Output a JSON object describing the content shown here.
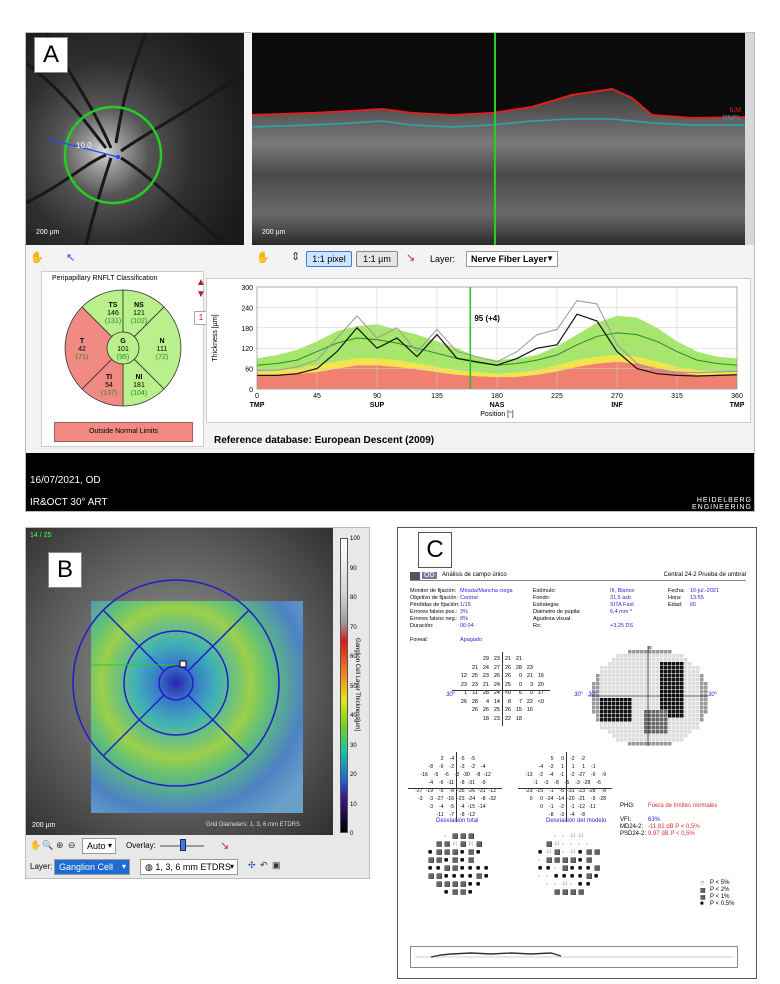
{
  "panelA": {
    "letter": "A",
    "scale_fundus": "200 µm",
    "scale_oct": "200 µm",
    "fundus_measure": "10.0",
    "layer_labels": {
      "ilm": "ILM",
      "rnfl": "RNFL"
    },
    "toolbar": {
      "pixel_btn": "1:1 pixel",
      "um_btn": "1:1 µm",
      "layer_label": "Layer:",
      "layer_value": "Nerve Fiber Layer"
    },
    "classification": {
      "title": "Peripapillary RNFLT Classification",
      "sectors": [
        {
          "id": "TS",
          "value": "146",
          "normal": "(131)",
          "status": "normal"
        },
        {
          "id": "NS",
          "value": "121",
          "normal": "(102)",
          "status": "normal"
        },
        {
          "id": "T",
          "value": "42",
          "normal": "(71)",
          "status": "outside"
        },
        {
          "id": "G",
          "value": "101",
          "normal": "(95)",
          "status": "normal"
        },
        {
          "id": "N",
          "value": "111",
          "normal": "(72)",
          "status": "normal"
        },
        {
          "id": "TI",
          "value": "54",
          "normal": "(137)",
          "status": "outside"
        },
        {
          "id": "NI",
          "value": "181",
          "normal": "(104)",
          "status": "normal"
        }
      ],
      "result": "Outside Normal Limits"
    },
    "page_indicator": "1",
    "chart_data": {
      "type": "line",
      "ylabel": "Thickness [µm]",
      "xlabel": "Position [°]",
      "xlim": [
        0,
        360
      ],
      "ylim": [
        0,
        300
      ],
      "x_ticks": [
        "0",
        "45",
        "90",
        "135",
        "180",
        "225",
        "270",
        "315",
        "360"
      ],
      "y_ticks": [
        "0",
        "60",
        "120",
        "180",
        "240",
        "300"
      ],
      "x_region_labels": [
        {
          "x": 0,
          "label": "TMP"
        },
        {
          "x": 90,
          "label": "SUP"
        },
        {
          "x": 180,
          "label": "NAS"
        },
        {
          "x": 270,
          "label": "INF"
        },
        {
          "x": 360,
          "label": "TMP"
        }
      ],
      "cursor": {
        "x": 160,
        "label": "95 (+4)"
      },
      "x": [
        0,
        15,
        30,
        45,
        60,
        75,
        90,
        105,
        120,
        135,
        150,
        165,
        180,
        195,
        210,
        225,
        240,
        255,
        270,
        285,
        300,
        315,
        330,
        345,
        360
      ],
      "series": [
        {
          "values": [
            40,
            40,
            45,
            60,
            110,
            180,
            120,
            150,
            95,
            160,
            90,
            80,
            70,
            90,
            120,
            130,
            220,
            200,
            110,
            60,
            45,
            40,
            38,
            40,
            42
          ]
        },
        {
          "values": [
            55,
            55,
            65,
            85,
            150,
            215,
            150,
            180,
            110,
            175,
            110,
            95,
            80,
            110,
            160,
            175,
            260,
            250,
            130,
            75,
            55,
            50,
            48,
            50,
            52
          ]
        }
      ],
      "normal_band": {
        "upper": [
          90,
          100,
          115,
          140,
          170,
          185,
          190,
          175,
          160,
          140,
          120,
          95,
          85,
          90,
          100,
          125,
          160,
          195,
          215,
          210,
          180,
          140,
          110,
          95,
          90
        ],
        "mean": [
          70,
          75,
          85,
          110,
          135,
          150,
          145,
          135,
          120,
          105,
          90,
          78,
          70,
          75,
          85,
          100,
          130,
          155,
          165,
          160,
          140,
          110,
          85,
          75,
          70
        ],
        "borderline": [
          50,
          55,
          60,
          70,
          80,
          90,
          90,
          85,
          75,
          65,
          55,
          50,
          45,
          48,
          55,
          70,
          85,
          95,
          100,
          95,
          80,
          65,
          55,
          50,
          50
        ],
        "lower": [
          40,
          42,
          45,
          50,
          60,
          70,
          70,
          65,
          58,
          50,
          42,
          38,
          35,
          36,
          42,
          52,
          65,
          75,
          80,
          75,
          62,
          50,
          42,
          40,
          40
        ]
      }
    },
    "reference_db": "Reference database: European Descent (2009)",
    "exam_date": "16/07/2021, OD",
    "exam_mode": "IR&OCT 30° ART",
    "brand_line1": "HEIDELBERG",
    "brand_line2": "ENGINEERING"
  },
  "panelB": {
    "letter": "B",
    "counter": "14 / 25",
    "scale": "200 µm",
    "colorbar_title": "Ganglion Cell Layer Thickness[µm]",
    "colorbar_ticks": [
      "100",
      "90",
      "80",
      "70",
      "60",
      "50",
      "40",
      "30",
      "20",
      "10",
      "0"
    ],
    "footer_text": "Grid Diameters: 1, 3, 6 mm ETDRS",
    "toolbar": {
      "auto": "Auto",
      "overlay": "Overlay:",
      "layer_label": "Layer:",
      "layer_value": "Ganglion Cell Layer",
      "grid_value": "1, 3, 6 mm ETDRS"
    }
  },
  "panelC": {
    "letter": "C",
    "header": {
      "eye": "OD",
      "title": "Análisis de campo único",
      "program": "Central 24-2 Prueba de umbral"
    },
    "col1": [
      {
        "label": "Monitor de fijación:",
        "value": "Mirada/Mancha ciega"
      },
      {
        "label": "Objetivo de fijación:",
        "value": "Central"
      },
      {
        "label": "Pérdidas de fijación:",
        "value": "1/15"
      },
      {
        "label": "Errores falsos pos.:",
        "value": "3%"
      },
      {
        "label": "Errores falsos neg.:",
        "value": "8%"
      },
      {
        "label": "Duración:",
        "value": "06:04"
      },
      {
        "label": "Foveal:",
        "value": "Apagado"
      }
    ],
    "col2": [
      {
        "label": "Estímulo:",
        "value": "III, Blanco"
      },
      {
        "label": "Fondo:",
        "value": "31,5 asb"
      },
      {
        "label": "Estrategia:",
        "value": "SITA Fast"
      },
      {
        "label": "Diámetro de pupila:",
        "value": "6,4 mm *"
      },
      {
        "label": "Agudeza visual:",
        "value": ""
      },
      {
        "label": "Rx:",
        "value": "+3,25 DS"
      }
    ],
    "col3": [
      {
        "label": "Fecha:",
        "value": "16-jul.-2021"
      },
      {
        "label": "Hora:",
        "value": "13:55"
      },
      {
        "label": "Edad:",
        "value": "65"
      }
    ],
    "threshold_rows": [
      "29 23 21 21",
      "21 24 27 26 28 23",
      "12 25 23 26 26 0 21 16",
      "23 23 21 24 25 0 3 20",
      "1 11 28 24 <0 6 0 17",
      "26 28 4 14 8 7 22 <0",
      "26 26 25 26 15 16",
      "18 23 22 18"
    ],
    "axis_30": "30°",
    "total_dev_rows": [
      "2 -4 -5 -5",
      "-8 -6 -2 -3 -2 -4",
      "-16 -5 -6 -3 -30 -8 -12",
      "-4 -6 -11 -8 -31 -9",
      "-27 -19 -5 -8 -35 -26 -31 -12",
      "-3 -3 -27 -16 -23 -24 -8 -32",
      "-3 -4 -5 -4 -15 -14",
      "-11 -7 -8 -12"
    ],
    "pattern_dev_rows": [
      "5 0 -2 -2",
      "-4 -2 1 1 1 -1",
      "-13 -2 -4 -1 -2 -27 -6 -9",
      "-1 -3 -8 -5 -3 -28 -6",
      "-23 -15 -1 -5 -31 -23 -28 -8",
      "0 0 -24 -14 -20 -21 -5 -28",
      "0 -1 -2 -1 -12 -11",
      "-8 -3 -4 -8"
    ],
    "total_dev_label": "Desviación total",
    "pattern_dev_label": "Desviación del modelo",
    "ght_label": "PHG:",
    "ght_value": "Fuera de límites normales",
    "vfi_label": "VFI:",
    "vfi_value": "63%",
    "md_label": "MD24-2:",
    "md_value": "-11,82 dB P < 0,5%",
    "psd_label": "PSD24-2:",
    "psd_value": "9,97 dB P < 0,5%",
    "legend": [
      "P < 5%",
      "P < 2%",
      "P < 1%",
      "P < 0,5%"
    ],
    "colors": {
      "blue": "#1a1ad8",
      "red": "#e23030"
    }
  }
}
